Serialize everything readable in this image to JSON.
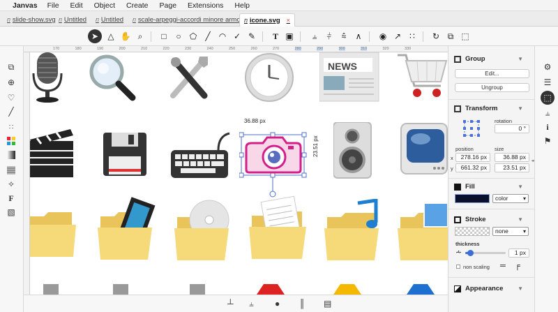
{
  "menu": {
    "app": "Janvas",
    "items": [
      "File",
      "Edit",
      "Object",
      "Create",
      "Page",
      "Extensions",
      "Help"
    ]
  },
  "tabs": [
    {
      "label": "slide-show.svg",
      "active": false
    },
    {
      "label": "Untitled",
      "active": false
    },
    {
      "label": "Untitled",
      "active": false
    },
    {
      "label": "scale-arpeggi-accordi minore armonico.svg",
      "active": false
    },
    {
      "label": "icone.svg",
      "active": true,
      "close": "×"
    }
  ],
  "ruler": {
    "ticks": [
      "170",
      "180",
      "190",
      "200",
      "210",
      "220",
      "230",
      "240",
      "250",
      "260",
      "270",
      "280",
      "290",
      "300",
      "310",
      "320",
      "330"
    ]
  },
  "selection": {
    "width_label": "36.88 px",
    "height_label": "23.51 px"
  },
  "icons": [
    "microphone-icon",
    "magnifier-icon",
    "tools-icon",
    "clock-icon",
    "news-icon",
    "cart-icon",
    "clapper-icon",
    "floppy-icon",
    "keyboard-icon",
    "camera-icon",
    "speaker-icon",
    "tv-icon",
    "folder-icon",
    "folder-film-icon",
    "folder-disc-icon",
    "folder-document-icon",
    "folder-music-icon",
    "folder-picture-icon"
  ],
  "panel": {
    "group": {
      "title": "Group",
      "edit": "Edit...",
      "ungroup": "Ungroup"
    },
    "transform": {
      "title": "Transform",
      "rotation_label": "rotation",
      "rotation": "0 °",
      "position_label": "position",
      "size_label": "size",
      "x_label": "x",
      "y_label": "y",
      "x": "278.16 px",
      "y": "661.32 px",
      "w": "36.88 px",
      "h": "23.51 px"
    },
    "fill": {
      "title": "Fill",
      "type": "color",
      "color": "#0a0f2c"
    },
    "stroke": {
      "title": "Stroke",
      "type": "none",
      "thickness_label": "thickness",
      "thickness": "1 px",
      "thickness_fraction": 0.05,
      "non_scaling": "non scaling"
    },
    "appearance": {
      "title": "Appearance"
    }
  },
  "colors": {
    "accent": "#3b6fd4",
    "selection": "#4a6fd0",
    "camera": "#d41f8a"
  }
}
